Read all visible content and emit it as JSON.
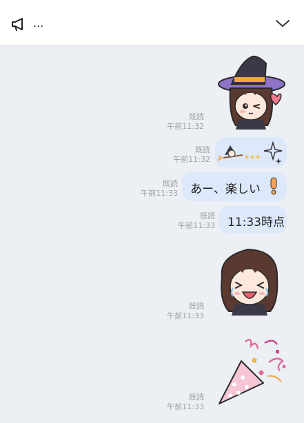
{
  "header": {
    "title": "...",
    "left_icon": "megaphone-icon",
    "right_icon": "chevron-down-icon"
  },
  "messages": [
    {
      "type": "sticker",
      "sticker": "witch-girl-wink-heart-sticker",
      "read": "既読",
      "time": "午前11:32"
    },
    {
      "type": "emoji",
      "content": "witch-on-broom-with-sparkles-emoji",
      "read": "既読",
      "time": "午前11:32"
    },
    {
      "type": "text",
      "text": "あー、楽しい",
      "emoji": "exclamation-emoji",
      "read": "既読",
      "time": "午前11:33"
    },
    {
      "type": "text",
      "text": "11:33時点",
      "read": "既読",
      "time": "午前11:33"
    },
    {
      "type": "sticker",
      "sticker": "girl-laughing-crying-sticker",
      "read": "既読",
      "time": "午前11:33"
    },
    {
      "type": "sticker",
      "sticker": "party-popper-sticker",
      "read": "既読",
      "time": "午前11:33"
    }
  ],
  "colors": {
    "background": "#eceff4",
    "bubble": "#dde8fb",
    "meta_text": "#9aa0a6"
  }
}
